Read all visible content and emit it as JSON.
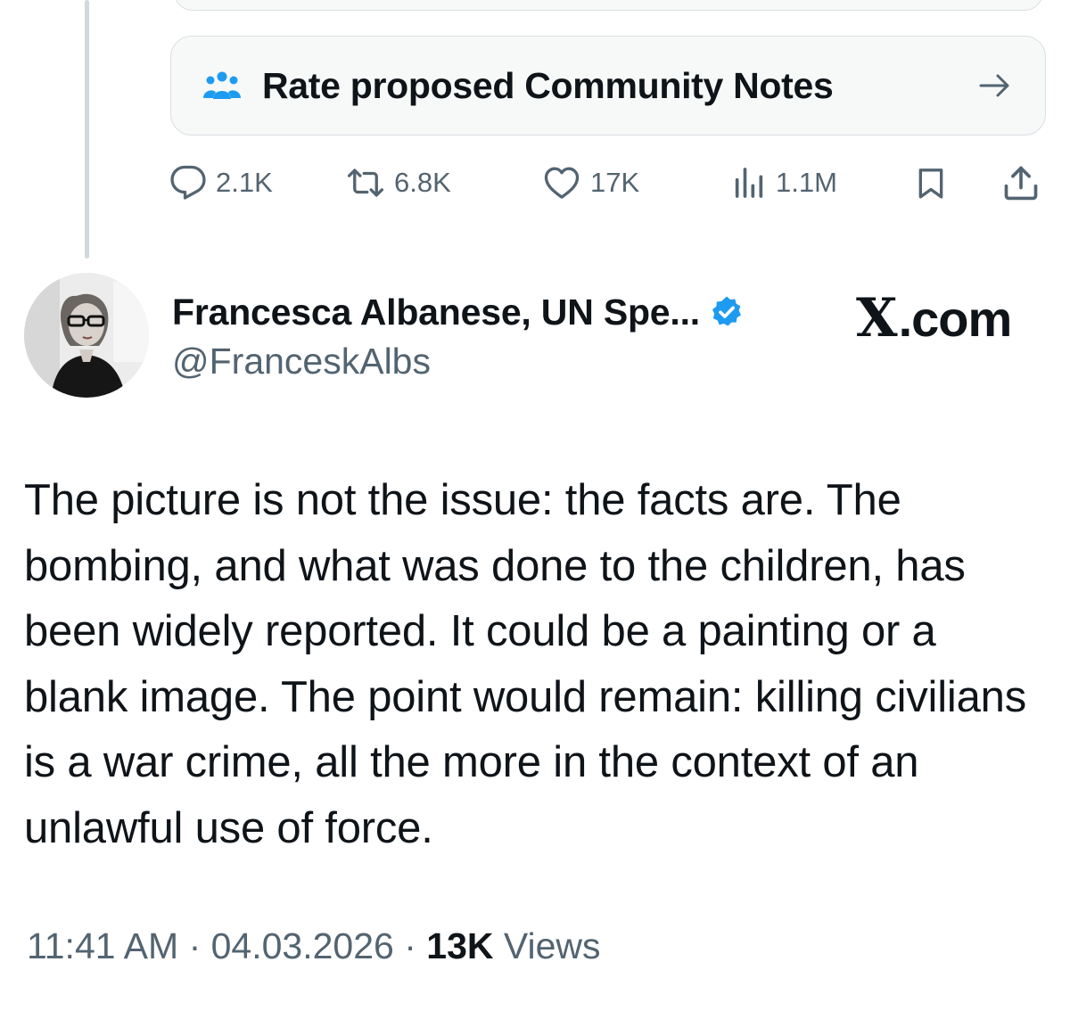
{
  "community_notes": {
    "label": "Rate proposed Community Notes"
  },
  "actions": {
    "replies": "2.1K",
    "reposts": "6.8K",
    "likes": "17K",
    "views": "1.1M"
  },
  "author": {
    "display_name": "Francesca Albanese, UN Spe...",
    "handle": "@FranceskAlbs",
    "verified": true
  },
  "source_label": ".com",
  "source_mark": "X",
  "tweet": {
    "text": "The picture is not the issue: the facts are. The bombing, and what was done to the children, has been widely reported. It could be a painting or a blank image. The point would remain: killing civilians is a war crime, all the more in the context of an unlawful use of force."
  },
  "meta": {
    "time": "11:41 AM",
    "separator": " · ",
    "date": "04.03.2026",
    "views_count": "13K",
    "views_label": " Views"
  },
  "colors": {
    "text_primary": "#0f1419",
    "text_secondary": "#536471",
    "accent_blue": "#1d9bf0",
    "card_border": "#dadfe3",
    "card_bg": "#f7f9f9"
  },
  "icons": {
    "community": "people-icon",
    "arrow": "arrow-right-icon",
    "reply": "comment-icon",
    "repost": "repost-icon",
    "like": "heart-icon",
    "views": "analytics-icon",
    "bookmark": "bookmark-icon",
    "share": "share-icon",
    "verified": "verified-badge-icon"
  }
}
